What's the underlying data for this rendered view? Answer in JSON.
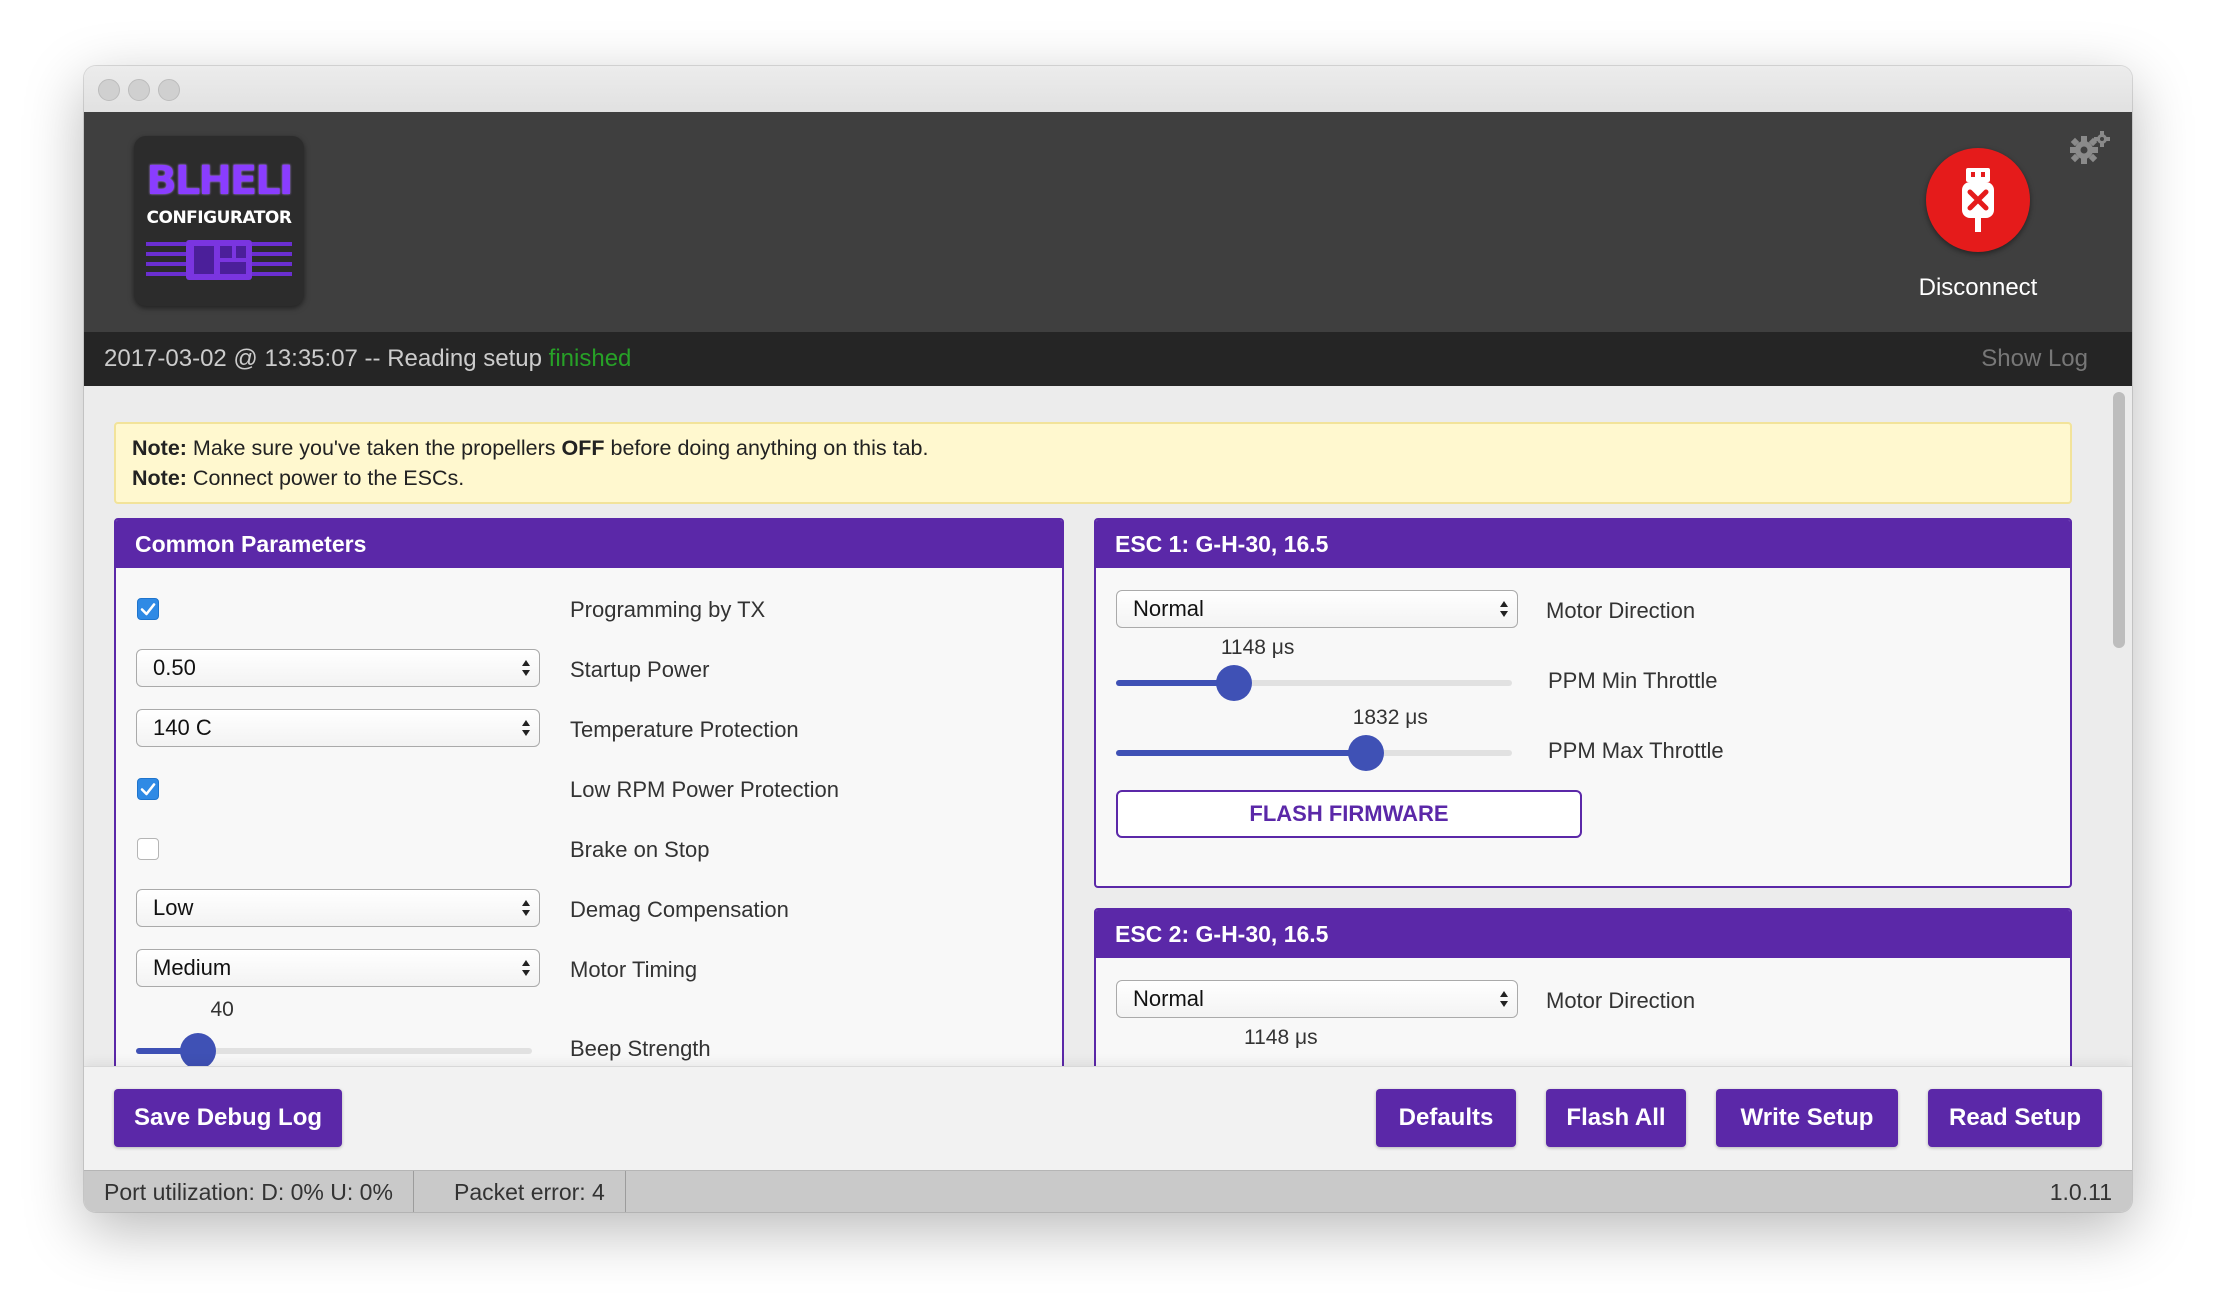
{
  "window": {
    "traffic_lights": [
      "close",
      "minimize",
      "zoom"
    ]
  },
  "header": {
    "logo_title": "BLHELI",
    "logo_subtitle": "CONFIGURATOR",
    "disconnect_label": "Disconnect",
    "log": {
      "timestamp": "2017-03-02 @ 13:35:07",
      "message": " -- Reading setup ",
      "status": "finished",
      "status_color": "#27a127"
    },
    "show_log": "Show Log"
  },
  "note": {
    "line1_bold": "Note:",
    "line1_pre": " Make sure you've taken the propellers ",
    "line1_strong": "OFF",
    "line1_post": " before doing anything on this tab.",
    "line2_bold": "Note:",
    "line2_text": " Connect power to the ESCs."
  },
  "common": {
    "title": "Common Parameters",
    "programming_by_tx": {
      "label": "Programming by TX",
      "checked": true
    },
    "startup_power": {
      "label": "Startup Power",
      "value": "0.50"
    },
    "temperature_protection": {
      "label": "Temperature Protection",
      "value": "140 C"
    },
    "low_rpm_power_protection": {
      "label": "Low RPM Power Protection",
      "checked": true
    },
    "brake_on_stop": {
      "label": "Brake on Stop",
      "checked": false
    },
    "demag_compensation": {
      "label": "Demag Compensation",
      "value": "Low"
    },
    "motor_timing": {
      "label": "Motor Timing",
      "value": "Medium"
    },
    "beep_strength": {
      "label": "Beep Strength",
      "value": "40",
      "fraction": 0.157
    }
  },
  "esc1": {
    "title": "ESC 1: G-H-30, 16.5",
    "motor_direction": {
      "label": "Motor Direction",
      "value": "Normal"
    },
    "ppm_min_throttle": {
      "label": "PPM Min Throttle",
      "value": "1148 μs",
      "fraction": 0.297
    },
    "ppm_max_throttle": {
      "label": "PPM Max Throttle",
      "value": "1832 μs",
      "fraction": 0.632
    },
    "flash_firmware": "FLASH FIRMWARE"
  },
  "esc2": {
    "title": "ESC 2: G-H-30, 16.5",
    "motor_direction": {
      "label": "Motor Direction",
      "value": "Normal"
    },
    "ppm_min_throttle": {
      "value": "1148 μs"
    }
  },
  "toolbar": {
    "save_debug_log": "Save Debug Log",
    "defaults": "Defaults",
    "flash_all": "Flash All",
    "write_setup": "Write Setup",
    "read_setup": "Read Setup"
  },
  "statusbar": {
    "port_utilization": "Port utilization: D: 0% U: 0%",
    "packet_error": "Packet error: 4",
    "version": "1.0.11"
  },
  "colors": {
    "accent": "#5b28a8",
    "slider": "#3f51b5",
    "disconnect": "#e51b1b",
    "header_bg": "#3f3f3f",
    "log_bg": "#252525",
    "note_bg": "#fff8cf",
    "checkbox": "#2f8ae5"
  },
  "icons": [
    "gear-icon",
    "usb-disconnect-icon",
    "checkmark-icon",
    "select-arrows-icon",
    "logo-board-icon"
  ]
}
